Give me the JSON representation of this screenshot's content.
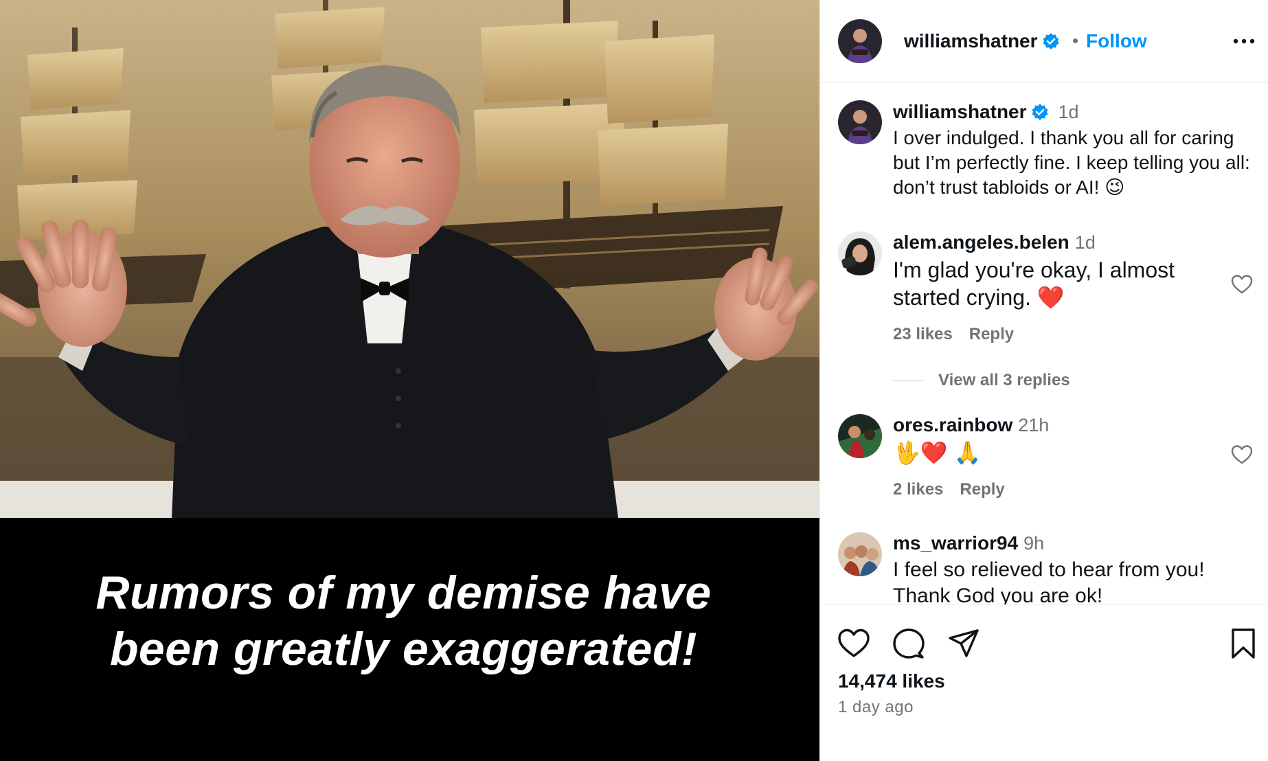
{
  "post": {
    "caption_line1": "Rumors of my demise have",
    "caption_line2": "been greatly exaggerated!"
  },
  "header": {
    "username": "williamshatner",
    "separator": "•",
    "follow_label": "Follow",
    "more_icon": "more-horizontal-icon"
  },
  "colors": {
    "accent": "#0095f6",
    "verified": "#0095f6",
    "secondary_text": "#737373",
    "heart_red": "#ed1c24"
  },
  "comments": [
    {
      "username": "williamshatner",
      "time": "1d",
      "text": "I over indulged. I thank you all for caring but I’m perfectly fine. I keep telling you all: don’t trust tabloids or AI! 😉",
      "verified": true
    },
    {
      "username": "alem.angeles.belen",
      "time": "1d",
      "text": "I'm glad you're okay, I almost started crying. ❤️",
      "likes": "23 likes",
      "reply": "Reply",
      "view_replies": "View all 3 replies"
    },
    {
      "username": "ores.rainbow",
      "time": "21h",
      "text": "🖖❤️ 🙏",
      "likes": "2 likes",
      "reply": "Reply"
    },
    {
      "username": "ms_warrior94",
      "time": "9h",
      "text": "I feel so relieved to hear from you! Thank God you are ok!"
    }
  ],
  "actions": {
    "like_icon": "heart-icon",
    "comment_icon": "comment-icon",
    "share_icon": "share-icon",
    "save_icon": "bookmark-icon",
    "likes_count": "14,474 likes",
    "posted_ago": "1 day ago"
  }
}
